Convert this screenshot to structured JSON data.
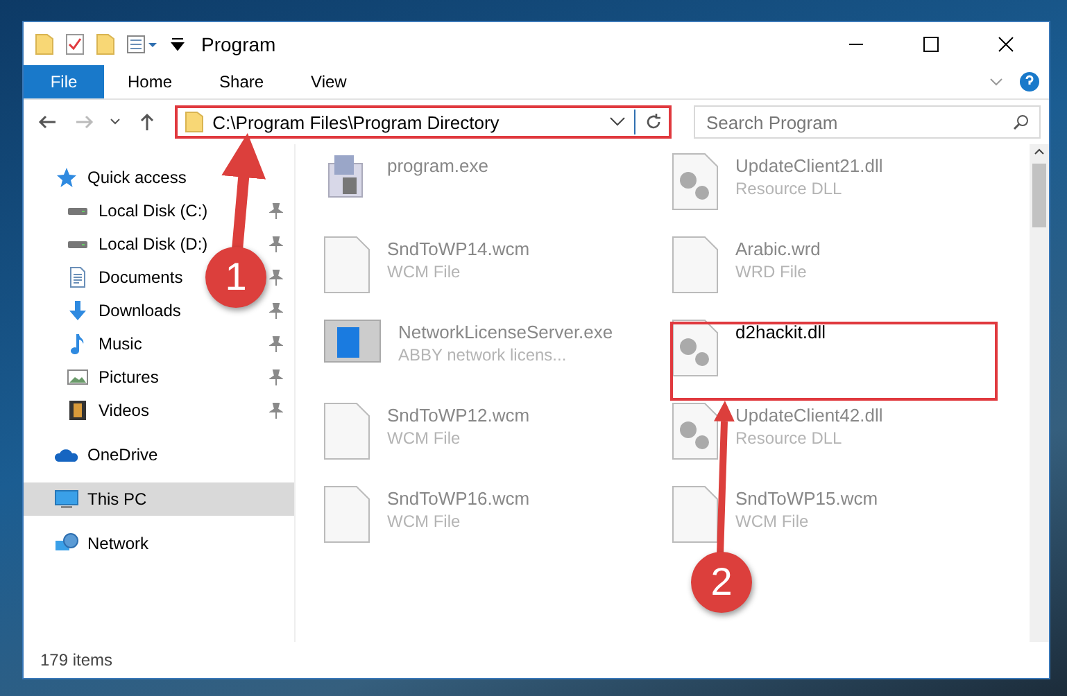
{
  "window": {
    "title": "Program"
  },
  "ribbon_tabs": [
    {
      "label": "File",
      "selected": true
    },
    {
      "label": "Home",
      "selected": false
    },
    {
      "label": "Share",
      "selected": false
    },
    {
      "label": "View",
      "selected": false
    }
  ],
  "address": {
    "value": "C:\\Program Files\\Program Directory",
    "highlighted": true
  },
  "search": {
    "placeholder": "Search Program"
  },
  "sidebar": {
    "items": [
      {
        "label": "Quick access",
        "kind": "star",
        "selected": false,
        "pinned": false,
        "children": [
          {
            "label": "Local Disk (C:)",
            "kind": "drive",
            "selected": false,
            "pinned": true
          },
          {
            "label": "Local Disk (D:)",
            "kind": "drive",
            "selected": false,
            "pinned": true
          },
          {
            "label": "Documents",
            "kind": "document",
            "selected": false,
            "pinned": true
          },
          {
            "label": "Downloads",
            "kind": "download",
            "selected": false,
            "pinned": true
          },
          {
            "label": "Music",
            "kind": "music",
            "selected": false,
            "pinned": true
          },
          {
            "label": "Pictures",
            "kind": "pictures",
            "selected": false,
            "pinned": true
          },
          {
            "label": "Videos",
            "kind": "video",
            "selected": false,
            "pinned": true
          }
        ]
      },
      {
        "label": "OneDrive",
        "kind": "cloud",
        "selected": false,
        "pinned": false
      },
      {
        "label": "This PC",
        "kind": "monitor",
        "selected": true,
        "pinned": false
      },
      {
        "label": "Network",
        "kind": "network",
        "selected": false,
        "pinned": false
      }
    ]
  },
  "files": [
    {
      "name": "program.exe",
      "kind": "installer",
      "highlighted": false
    },
    {
      "name": "UpdateClient21.dll",
      "type": "Resource DLL",
      "kind": "gears",
      "highlighted": false
    },
    {
      "name": "SndToWP14.wcm",
      "type": "WCM File",
      "kind": "blank",
      "highlighted": false
    },
    {
      "name": "Arabic.wrd",
      "type": "WRD File",
      "kind": "blank",
      "highlighted": false
    },
    {
      "name": "NetworkLicenseServer.exe",
      "type": "ABBY network licens...",
      "kind": "app",
      "highlighted": false
    },
    {
      "name": "d2hackit.dll",
      "kind": "gears",
      "highlighted": true
    },
    {
      "name": "SndToWP12.wcm",
      "type": "WCM File",
      "kind": "blank",
      "highlighted": false
    },
    {
      "name": "UpdateClient42.dll",
      "type": "Resource DLL",
      "kind": "gears",
      "highlighted": false
    },
    {
      "name": "SndToWP16.wcm",
      "type": "WCM File",
      "kind": "blank",
      "highlighted": false
    },
    {
      "name": "SndToWP15.wcm",
      "type": "WCM File",
      "kind": "blank",
      "highlighted": false
    }
  ],
  "callouts": [
    {
      "number": "1"
    },
    {
      "number": "2"
    }
  ],
  "status_bar": {
    "count": "179 items"
  }
}
